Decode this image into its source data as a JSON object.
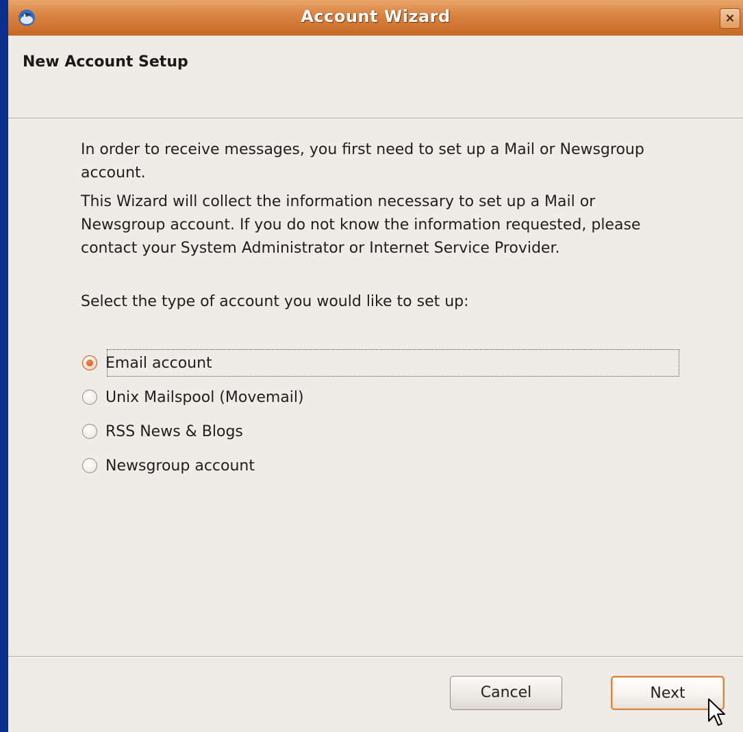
{
  "window": {
    "title": "Account Wizard",
    "close_glyph": "×"
  },
  "header": {
    "title": "New Account Setup"
  },
  "intro": {
    "paragraph1": "In order to receive messages, you first need to set up a Mail or Newsgroup account.",
    "paragraph2": "This Wizard will collect the information necessary to set up a Mail or Newsgroup account. If you do not know the information requested, please contact your System Administrator or Internet Service Provider.",
    "prompt": "Select the type of account you would like to set up:"
  },
  "account_types": {
    "selected": "Email account",
    "options": [
      {
        "label": "Email account",
        "checked": true
      },
      {
        "label": "Unix Mailspool (Movemail)",
        "checked": false
      },
      {
        "label": "RSS News & Blogs",
        "checked": false
      },
      {
        "label": "Newsgroup account",
        "checked": false
      }
    ]
  },
  "buttons": {
    "cancel": "Cancel",
    "next": "Next"
  },
  "icons": {
    "app": "thunderbird-icon",
    "close": "close-icon",
    "cursor": "mouse-pointer-icon"
  },
  "colors": {
    "titlebar": "#d9823f",
    "window_bg": "#efebe7",
    "desktop_bg": "#0b2f8c",
    "accent": "#d7843f"
  }
}
